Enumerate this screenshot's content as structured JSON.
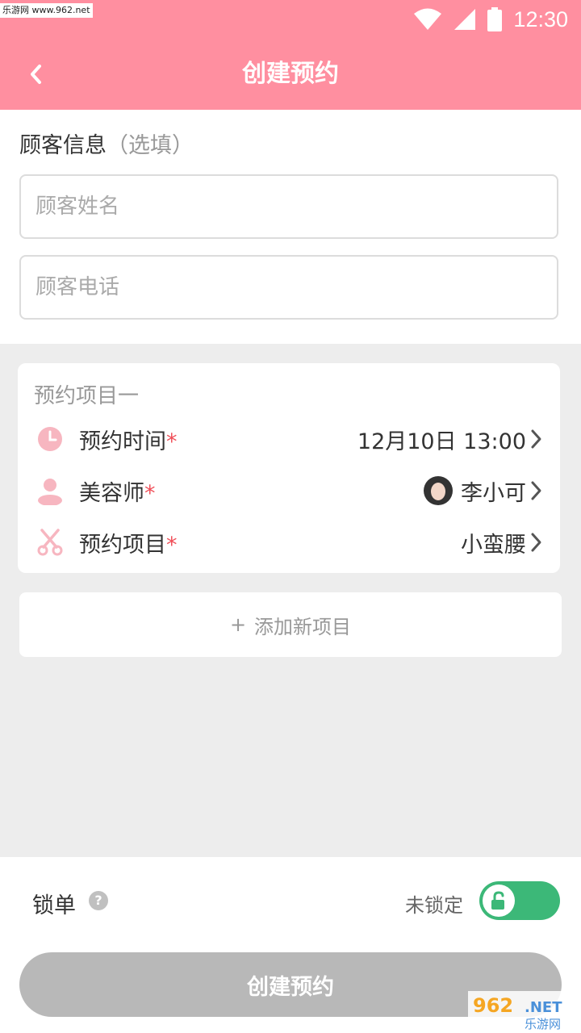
{
  "status_bar": {
    "watermark": "乐游网 www.962.net",
    "time": "12:30"
  },
  "header": {
    "title": "创建预约"
  },
  "customer_info": {
    "section_title": "顾客信息",
    "optional_hint": "（选填）",
    "name_placeholder": "顾客姓名",
    "phone_placeholder": "顾客电话"
  },
  "appointment_item": {
    "card_title": "预约项目一",
    "rows": [
      {
        "label": "预约时间",
        "required_mark": "*",
        "value": "12月10日 13:00",
        "icon": "clock-icon"
      },
      {
        "label": "美容师",
        "required_mark": "*",
        "value": "李小可",
        "icon": "person-icon"
      },
      {
        "label": "预约项目",
        "required_mark": "*",
        "value": "小蛮腰",
        "icon": "scissors-icon"
      }
    ]
  },
  "add_item": {
    "plus": "+",
    "label": "添加新项目"
  },
  "lock": {
    "label": "锁单",
    "help": "?",
    "status": "未锁定",
    "toggle_on": false
  },
  "submit_label": "创建预约",
  "colors": {
    "brand_pink": "#ff8fa0",
    "toggle_green": "#3cb878",
    "required_red": "#f0505a",
    "disabled_gray": "#b8b8b8"
  },
  "logo_text": "962.NET 乐游网"
}
